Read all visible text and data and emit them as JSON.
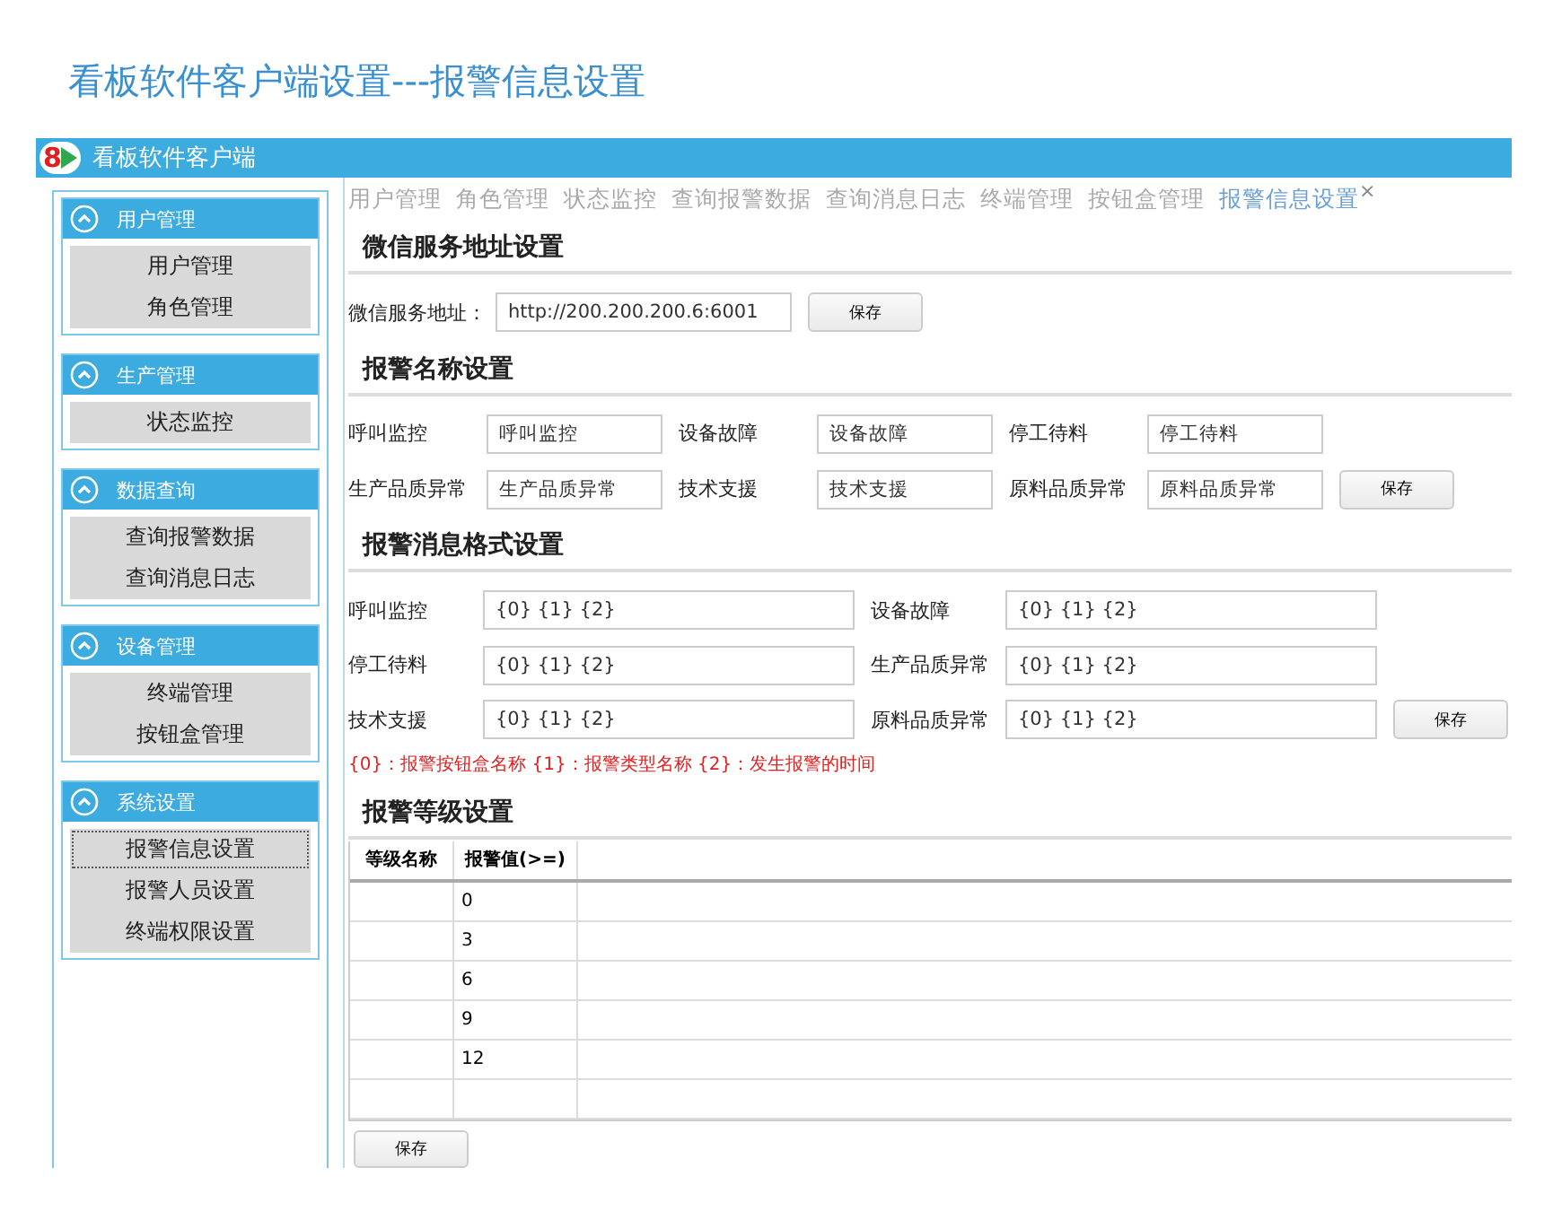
{
  "page_title": "看板软件客户端设置---报警信息设置",
  "window": {
    "title": "看板软件客户端",
    "logo_text": "8"
  },
  "sidebar": {
    "groups": [
      {
        "title": "用户管理",
        "expanded": true,
        "items": [
          {
            "label": "用户管理",
            "selected": false
          },
          {
            "label": "角色管理",
            "selected": false
          }
        ]
      },
      {
        "title": "生产管理",
        "expanded": true,
        "items": [
          {
            "label": "状态监控",
            "selected": false
          }
        ]
      },
      {
        "title": "数据查询",
        "expanded": true,
        "items": [
          {
            "label": "查询报警数据",
            "selected": false
          },
          {
            "label": "查询消息日志",
            "selected": false
          }
        ]
      },
      {
        "title": "设备管理",
        "expanded": true,
        "items": [
          {
            "label": "终端管理",
            "selected": false
          },
          {
            "label": "按钮盒管理",
            "selected": false
          }
        ]
      },
      {
        "title": "系统设置",
        "expanded": true,
        "items": [
          {
            "label": "报警信息设置",
            "selected": true
          },
          {
            "label": "报警人员设置",
            "selected": false
          },
          {
            "label": "终端权限设置",
            "selected": false
          }
        ]
      }
    ]
  },
  "tabs": [
    {
      "label": "用户管理",
      "selected": false
    },
    {
      "label": "角色管理",
      "selected": false
    },
    {
      "label": "状态监控",
      "selected": false
    },
    {
      "label": "查询报警数据",
      "selected": false
    },
    {
      "label": "查询消息日志",
      "selected": false
    },
    {
      "label": "终端管理",
      "selected": false
    },
    {
      "label": "按钮盒管理",
      "selected": false
    },
    {
      "label": "报警信息设置",
      "selected": true
    }
  ],
  "tab_close": "×",
  "wechat": {
    "heading": "微信服务地址设置",
    "label": "微信服务地址：",
    "value": "http://200.200.200.6:6001",
    "save": "保存"
  },
  "alarm_names": {
    "heading": "报警名称设置",
    "save": "保存",
    "fields": [
      {
        "label": "呼叫监控",
        "value": "呼叫监控"
      },
      {
        "label": "设备故障",
        "value": "设备故障"
      },
      {
        "label": "停工待料",
        "value": "停工待料"
      },
      {
        "label": "生产品质异常",
        "value": "生产品质异常"
      },
      {
        "label": "技术支援",
        "value": "技术支援"
      },
      {
        "label": "原料品质异常",
        "value": "原料品质异常"
      }
    ]
  },
  "alarm_formats": {
    "heading": "报警消息格式设置",
    "save": "保存",
    "note": "{0}：报警按钮盒名称 {1}：报警类型名称 {2}：发生报警的时间",
    "fields": [
      {
        "label": "呼叫监控",
        "value": "{0} {1} {2}"
      },
      {
        "label": "设备故障",
        "value": "{0} {1} {2}"
      },
      {
        "label": "停工待料",
        "value": "{0} {1} {2}"
      },
      {
        "label": "生产品质异常",
        "value": "{0} {1} {2}"
      },
      {
        "label": "技术支援",
        "value": "{0} {1} {2}"
      },
      {
        "label": "原料品质异常",
        "value": "{0} {1} {2}"
      }
    ]
  },
  "alarm_levels": {
    "heading": "报警等级设置",
    "save": "保存",
    "table": {
      "columns": [
        "等级名称",
        "报警值(>=)"
      ],
      "rows": [
        [
          "",
          "0"
        ],
        [
          "",
          "3"
        ],
        [
          "",
          "6"
        ],
        [
          "",
          "9"
        ],
        [
          "",
          "12"
        ]
      ]
    }
  }
}
